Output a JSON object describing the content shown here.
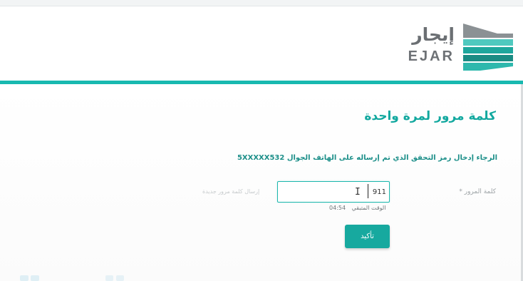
{
  "brand": {
    "name_ar": "إيجار",
    "name_en": "EJAR",
    "colors": {
      "accent": "#19b9b0",
      "title": "#12a89f",
      "button": "#17a99f",
      "logo_text": "#6b6f73"
    }
  },
  "page": {
    "title": "كلمة مرور لمرة واحدة",
    "instruction": "الرجاء إدخال رمز التحقق الذي تم إرساله على الهاتف الجوال 5XXXXX532"
  },
  "form": {
    "password_label": "كلمة المرور *",
    "password_value": "911",
    "resend_link": "إرسال كلمة مرور جديدة",
    "timer_label": "الوقت المتبقي",
    "timer_value": "04:54",
    "confirm_button": "تأكيد"
  },
  "icons": {
    "logo_mark": "ejar-logo-mark",
    "cursor": "text-cursor-icon"
  }
}
